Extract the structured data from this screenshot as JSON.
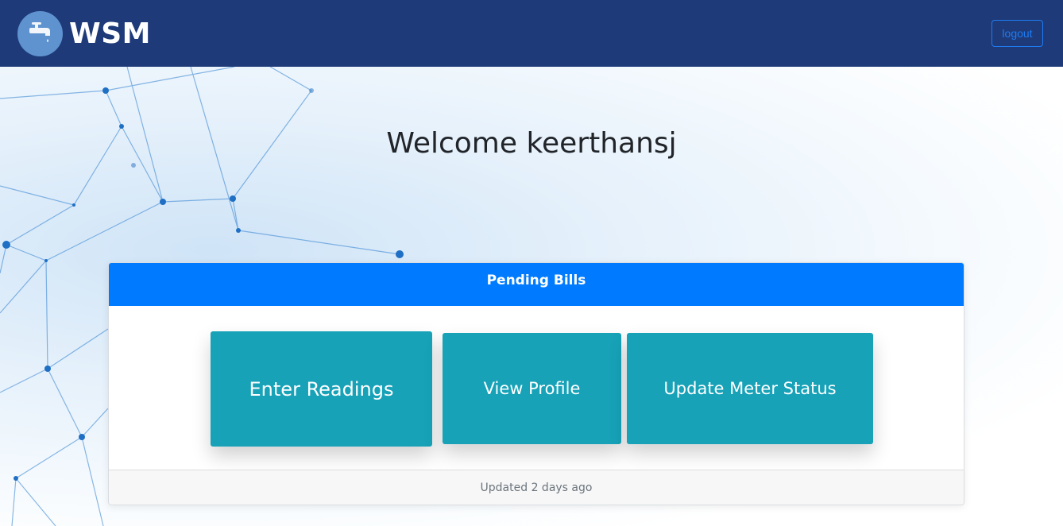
{
  "navbar": {
    "brand": "WSM",
    "logo_icon": "water-tap-icon",
    "logout_label": "logout"
  },
  "main": {
    "welcome": "Welcome keerthansj"
  },
  "card": {
    "header": "Pending Bills",
    "tiles": [
      {
        "label": "Enter Readings"
      },
      {
        "label": "View Profile"
      },
      {
        "label": "Update Meter Status"
      }
    ],
    "footer": "Updated 2 days ago"
  },
  "colors": {
    "navbar": "#1e3a78",
    "card_header": "#007bff",
    "tile": "#17a2b8",
    "logout": "#1f7cf2"
  }
}
